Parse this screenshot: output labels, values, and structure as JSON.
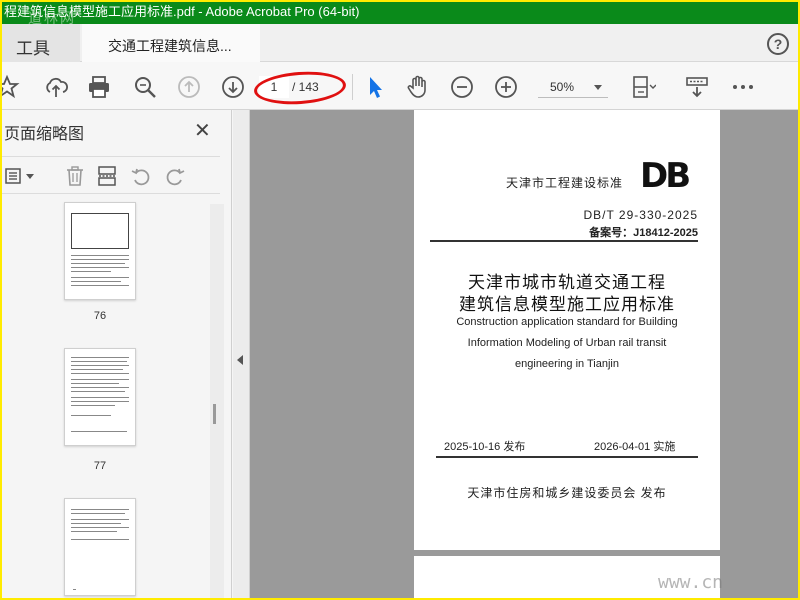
{
  "window": {
    "title": "程建筑信息模型施工应用标准.pdf - Adobe Acrobat Pro (64-bit)",
    "watermark_top": "道林网",
    "watermark_bottom": "www.cn"
  },
  "tabs": {
    "tools_label": "工具",
    "document_label": "交通工程建筑信息...",
    "help_glyph": "?"
  },
  "toolbar": {
    "page_current": "1",
    "page_total": "/ 143",
    "zoom": "50%",
    "icons": [
      "bookmark-star-icon",
      "cloud-upload-icon",
      "print-icon",
      "zoom-search-icon",
      "page-up-icon",
      "page-down-icon",
      "select-cursor-icon",
      "hand-tool-icon",
      "zoom-out-icon",
      "zoom-in-icon",
      "fit-page-icon",
      "read-mode-icon",
      "more-icon"
    ],
    "accent": "#1473e6"
  },
  "sidebar": {
    "title": "页面缩略图",
    "close_glyph": "✕",
    "thumbnails": [
      {
        "label": "76"
      },
      {
        "label": "77"
      },
      {
        "label": ""
      }
    ]
  },
  "document": {
    "standard_type": "天津市工程建设标准",
    "logo": "DB",
    "code": "DB/T 29-330-2025",
    "record": "备案号：J18412-2025",
    "title_cn_line1": "天津市城市轨道交通工程",
    "title_cn_line2": "建筑信息模型施工应用标准",
    "title_en_line1": "Construction application standard for Building",
    "title_en_line2": "Information Modeling of Urban rail transit",
    "title_en_line3": "engineering in Tianjin",
    "publish_date": "2025-10-16 发布",
    "implement_date": "2026-04-01 实施",
    "issuer": "天津市住房和城乡建设委员会 发布"
  },
  "colors": {
    "titlebar_bg": "#0a8a1a",
    "frame_border": "#ffeb00",
    "annotation_oval": "#e01010"
  }
}
